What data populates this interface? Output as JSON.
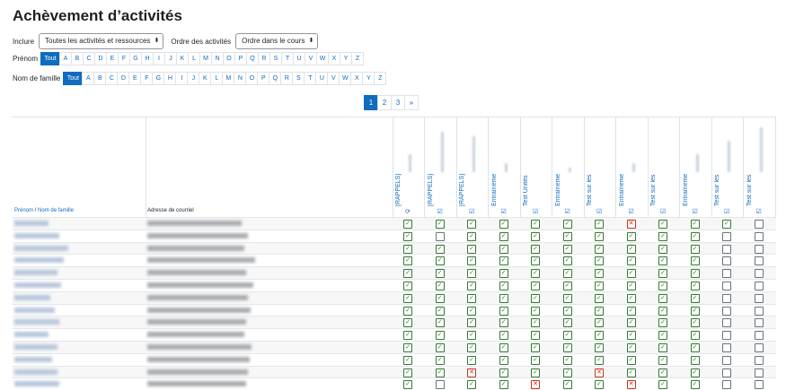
{
  "page": {
    "title": "Achèvement d’activités"
  },
  "filters": {
    "include_label": "Inclure",
    "include_value": "Toutes les activités et ressources",
    "order_label": "Ordre des activités",
    "order_value": "Ordre dans le cours"
  },
  "firstname_filter": {
    "label": "Prénom",
    "all": "Tout",
    "letters": [
      "A",
      "B",
      "C",
      "D",
      "E",
      "F",
      "G",
      "H",
      "I",
      "J",
      "K",
      "L",
      "M",
      "N",
      "O",
      "P",
      "Q",
      "R",
      "S",
      "T",
      "U",
      "V",
      "W",
      "X",
      "Y",
      "Z"
    ]
  },
  "lastname_filter": {
    "label": "Nom de famille",
    "all": "Tout",
    "letters": [
      "A",
      "B",
      "C",
      "D",
      "E",
      "F",
      "G",
      "H",
      "I",
      "J",
      "K",
      "L",
      "M",
      "N",
      "O",
      "P",
      "Q",
      "R",
      "S",
      "T",
      "U",
      "V",
      "W",
      "X",
      "Y",
      "Z"
    ]
  },
  "pagination": {
    "pages": [
      "1",
      "2",
      "3"
    ],
    "next": "»",
    "active": "1"
  },
  "table": {
    "col_name_a": "Prénom",
    "col_name_sep": " / ",
    "col_name_b": "Nom de famille",
    "col_email": "Adresse de courriel",
    "activities": [
      {
        "name": "[RAPPELS]",
        "icon": "refresh-icon"
      },
      {
        "name": "[RAPPELS]",
        "icon": "checkbox-icon"
      },
      {
        "name": "[RAPPELS]",
        "icon": "checkbox-icon"
      },
      {
        "name": "Entraîneme",
        "icon": "checkbox-icon"
      },
      {
        "name": "Test Unités",
        "icon": "checkbox-icon"
      },
      {
        "name": "Entraîneme",
        "icon": "checkbox-icon"
      },
      {
        "name": "Test sur les",
        "icon": "checkbox-icon"
      },
      {
        "name": "Entraîneme",
        "icon": "checkbox-icon"
      },
      {
        "name": "Test sur les",
        "icon": "checkbox-icon"
      },
      {
        "name": "Entraîneme",
        "icon": "checkbox-icon"
      },
      {
        "name": "Test sur les",
        "icon": "checkbox-icon"
      },
      {
        "name": "Test sur les",
        "icon": "checkbox-icon"
      }
    ],
    "status": [
      "cccccccxcccn",
      "cnccccccccnn",
      "ccccccccccnn",
      "ccccccccccnn",
      "ccccccccccnn",
      "ccccccccccnn",
      "ccccccccccnn",
      "ccccccccccnn",
      "ccccccccccnn",
      "ccccccccccnn",
      "ccccccccccnn",
      "ccccccccccnn",
      "ccxcccxcccnn",
      "cnccxccxccnn"
    ]
  },
  "colors": {
    "accent": "#0f6cbf",
    "complete": "#357a32",
    "failed": "#ca3120"
  }
}
